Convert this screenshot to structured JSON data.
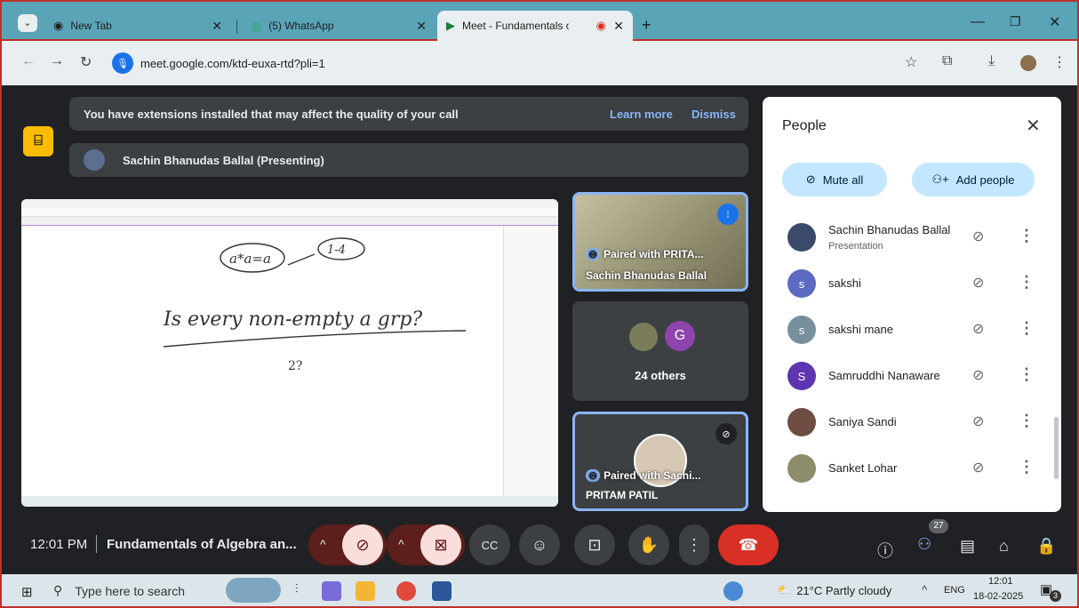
{
  "browser": {
    "tabs": [
      {
        "title": "New Tab"
      },
      {
        "title": "(5) WhatsApp"
      },
      {
        "title": "Meet - Fundamentals of Alg"
      }
    ],
    "url": "meet.google.com/ktd-euxa-rtd?pli=1"
  },
  "meet": {
    "extension_banner": "You have extensions installed that may affect the quality of your call",
    "learn_more": "Learn more",
    "dismiss": "Dismiss",
    "presenting_banner": "Sachin Bhanudas Ballal (Presenting)",
    "tiles": {
      "sachin": {
        "label": "Paired with PRITA...",
        "name": "Sachin Bhanudas Ballal"
      },
      "others": {
        "avatar_letter": "G",
        "label": "24 others"
      },
      "pritam": {
        "label": "Paired with Sachi...",
        "name": "PRITAM PATIL"
      }
    },
    "bottom": {
      "time": "12:01 PM",
      "title": "Fundamentals of Algebra an...",
      "people_count": "27"
    }
  },
  "people_panel": {
    "title": "People",
    "mute_all": "Mute all",
    "add_people": "Add people",
    "participants": [
      {
        "name": "Sachin Bhanudas Ballal",
        "sub": "Presentation",
        "avatar": "",
        "color": "#3b4a6b"
      },
      {
        "name": "sakshi",
        "sub": "",
        "avatar": "s",
        "color": "#5c6bc0"
      },
      {
        "name": "sakshi mane",
        "sub": "",
        "avatar": "s",
        "color": "#78909c"
      },
      {
        "name": "Samruddhi Nanaware",
        "sub": "",
        "avatar": "S",
        "color": "#5e35b1"
      },
      {
        "name": "Saniya Sandi",
        "sub": "",
        "avatar": "",
        "color": "#6d4c41"
      },
      {
        "name": "Sanket Lohar",
        "sub": "",
        "avatar": "",
        "color": "#8d8d6d"
      }
    ]
  },
  "taskbar": {
    "search_placeholder": "Type here to search",
    "weather": "21°C  Partly cloudy",
    "lang": "ENG",
    "time": "12:01",
    "date": "18-02-2025",
    "notif_count": "3"
  },
  "whiteboard": {
    "line1": "a*a=a",
    "line1b": "1-4",
    "line2": "Is every non-empty a grp?",
    "line3": "2?"
  }
}
